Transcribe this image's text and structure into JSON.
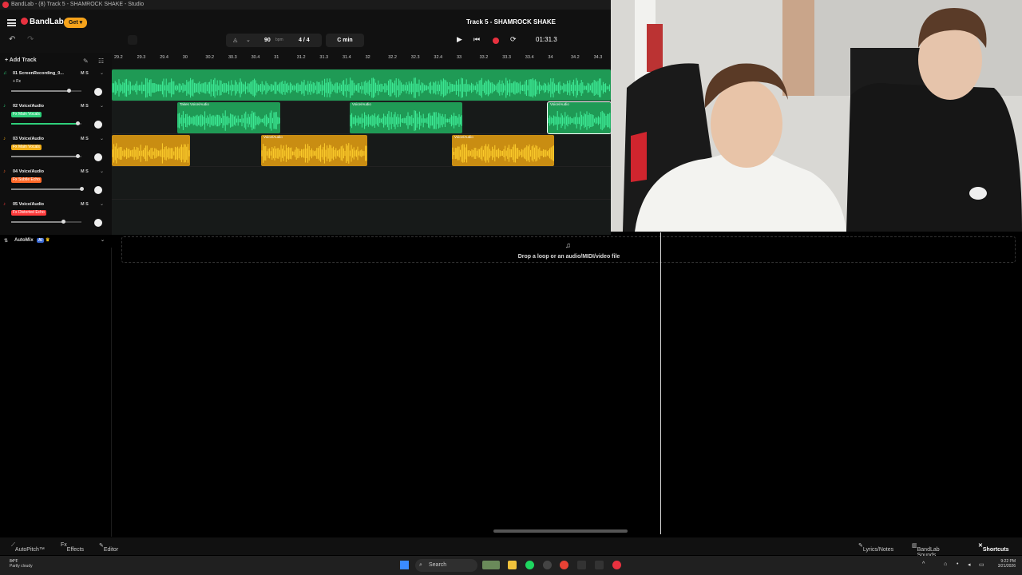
{
  "window": {
    "title": "BandLab - (8) Track 5 - SHAMROCK SHAKE - Studio"
  },
  "header": {
    "brand": "BandLab",
    "get_label": "Get",
    "song_title": "Track 5 - SHAMROCK SHAKE",
    "tempo": "90",
    "tempo_unit": "bpm",
    "time_sig": "4 / 4",
    "key": "C min",
    "time": "01:31.3"
  },
  "tracks_panel": {
    "add_track_label": "Add Track"
  },
  "ruler": [
    "29.2",
    "29.3",
    "29.4",
    "30",
    "30.2",
    "30.3",
    "30.4",
    "31",
    "31.2",
    "31.3",
    "31.4",
    "32",
    "32.2",
    "32.3",
    "32.4",
    "33",
    "33.2",
    "33.3",
    "33.4",
    "34",
    "34.2",
    "34.3"
  ],
  "tracks": [
    {
      "name": "01  ScreenRecording_0...",
      "fx": "+ Fx",
      "color": "#2ecf7a",
      "m": "M",
      "s": "S",
      "volume": 0.82
    },
    {
      "name": "02  Voice/Audio",
      "fx": "Fx  Main Vocals",
      "color": "#2ecf7a",
      "m": "M",
      "s": "S",
      "volume": 0.94
    },
    {
      "name": "03  Voice/Audio",
      "fx": "Fx  Main Vocals",
      "color": "#f2ae17",
      "m": "M",
      "s": "S",
      "volume": 0.94
    },
    {
      "name": "04  Voice/Audio",
      "fx": "Fx  Subtle Echo",
      "color": "#ff6a2a",
      "m": "M",
      "s": "S",
      "volume": 1.0
    },
    {
      "name": "05  Voice/Audio",
      "fx": "Fx  Distorted Echo",
      "color": "#ff3b3b",
      "m": "M",
      "s": "S",
      "volume": 0.74
    }
  ],
  "clips": {
    "track2_a_takes": "Takes",
    "track2_a": "Voice/Audio",
    "track2_b": "Voice/Audio",
    "track2_c": "Voice/Audio",
    "track3_b": "Voice/Audio",
    "track3_c": "Voice/Audio"
  },
  "automix": {
    "label": "AutoMix",
    "badge": "AI"
  },
  "dropzone": {
    "text": "Drop a loop or an audio/MIDI/video file"
  },
  "bottom_bar": {
    "autopitch": "AutoPitch™",
    "effects": "Effects",
    "editor": "Editor",
    "lyrics": "Lyrics/Notes",
    "sounds": "BandLab Sounds",
    "shortcuts": "Shortcuts"
  },
  "taskbar": {
    "weather_temp": "84°F",
    "weather_desc": "Partly cloudy",
    "search": "Search",
    "time": "9:22 PM",
    "date": "3/21/2026"
  }
}
